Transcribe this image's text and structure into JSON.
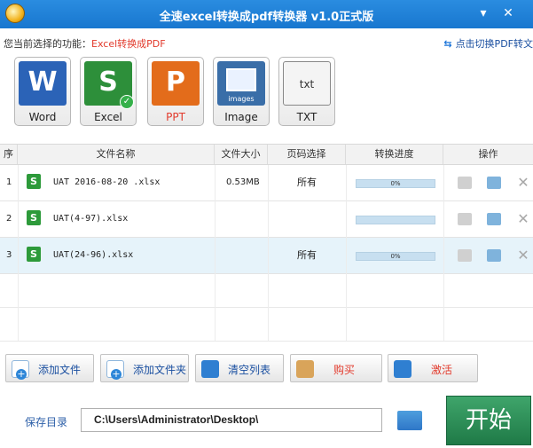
{
  "window": {
    "title": "全速excel转换成pdf转换器 v1.0正式版",
    "minimize_glyph": "▾",
    "close_glyph": "✕"
  },
  "function_bar": {
    "label": "您当前选择的功能：",
    "value": "Excel转换成PDF",
    "switch_link": "点击切换PDF转文"
  },
  "formats": [
    {
      "glyph": "W",
      "label": "Word",
      "icon": "word-icon"
    },
    {
      "glyph": "S",
      "label": "Excel",
      "icon": "excel-icon",
      "selected": true
    },
    {
      "glyph": "P",
      "label": "PPT",
      "icon": "ppt-icon"
    },
    {
      "glyph": "",
      "sublabel": "images",
      "label": "Image",
      "icon": "image-icon"
    },
    {
      "glyph": "txt",
      "label": "TXT",
      "icon": "txt-icon"
    }
  ],
  "table": {
    "headers": [
      "序",
      "文件名称",
      "文件大小",
      "页码选择",
      "转换进度",
      "操作"
    ],
    "rows": [
      {
        "index": "1",
        "name": "UAT 2016-08-20 .xlsx",
        "size": "0.53MB",
        "pages": "所有",
        "progress": "0%"
      },
      {
        "index": "2",
        "name": "UAT(4-97).xlsx",
        "size": "",
        "pages": "",
        "progress": ""
      },
      {
        "index": "3",
        "name": "UAT(24-96).xlsx",
        "size": "",
        "pages": "所有",
        "progress": "0%"
      }
    ]
  },
  "toolbar": {
    "add_file": "添加文件",
    "add_folder": "添加文件夹",
    "clear_list": "清空列表",
    "buy": "购买",
    "activate": "激活"
  },
  "output": {
    "label": "保存目录",
    "path": "C:\\Users\\Administrator\\Desktop\\"
  },
  "start_button": "开始"
}
